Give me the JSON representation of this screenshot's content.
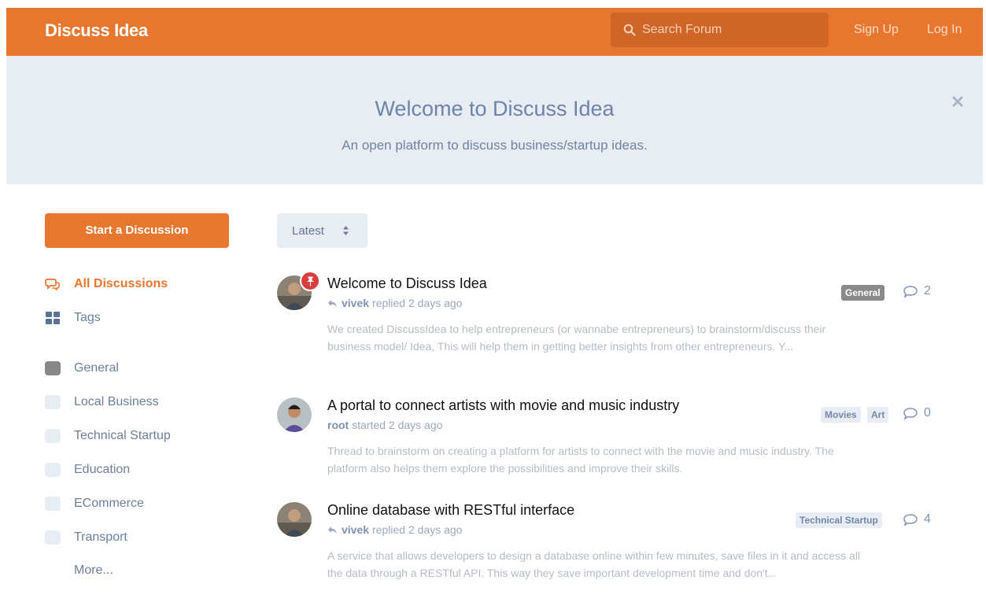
{
  "header": {
    "brand": "Discuss Idea",
    "search_placeholder": "Search Forum",
    "signup": "Sign Up",
    "login": "Log In",
    "accent_color": "#e7762f"
  },
  "hero": {
    "title": "Welcome to Discuss Idea",
    "subtitle": "An open platform to discuss business/startup ideas.",
    "close_icon": "close-icon"
  },
  "sidebar": {
    "start_button": "Start a Discussion",
    "nav": [
      {
        "label": "All Discussions",
        "icon": "discussions-icon",
        "active": true
      },
      {
        "label": "Tags",
        "icon": "tags-icon",
        "active": false
      }
    ],
    "tags": [
      {
        "label": "General",
        "color": "#888888"
      },
      {
        "label": "Local Business",
        "color": "#e8ecf3"
      },
      {
        "label": "Technical Startup",
        "color": "#e8ecf3"
      },
      {
        "label": "Education",
        "color": "#e8ecf3"
      },
      {
        "label": "ECommerce",
        "color": "#e8ecf3"
      },
      {
        "label": "Transport",
        "color": "#e8ecf3"
      }
    ],
    "more": "More..."
  },
  "sort": {
    "label": "Latest"
  },
  "discussions": [
    {
      "title": "Welcome to Discuss Idea",
      "user": "vivek",
      "action": "replied 2 days ago",
      "excerpt": "We created DiscussIdea to help entrepreneurs (or wannabe entrepreneurs) to brainstorm/discuss their business model/ Idea, This will help them in getting better insights from other entrepreneurs. Y...",
      "tags": [
        "General"
      ],
      "replies": "2",
      "pinned": true
    },
    {
      "title": "A portal to connect artists with movie and music industry",
      "user": "root",
      "action": "started 2 days ago",
      "excerpt": "Thread to brainstorm on creating a platform for artists to connect with the movie and music industry. The platform also helps them explore the possibilities and improve their skills.",
      "tags": [
        "Movies",
        "Art"
      ],
      "replies": "0",
      "pinned": false
    },
    {
      "title": "Online database with RESTful interface",
      "user": "vivek",
      "action": "replied 2 days ago",
      "excerpt": "A service that allows developers to design a database online within few minutes, save files in it and access all the data through a RESTful API. This way they save important development time and don't...",
      "tags": [
        "Technical Startup"
      ],
      "replies": "4",
      "pinned": false
    }
  ]
}
